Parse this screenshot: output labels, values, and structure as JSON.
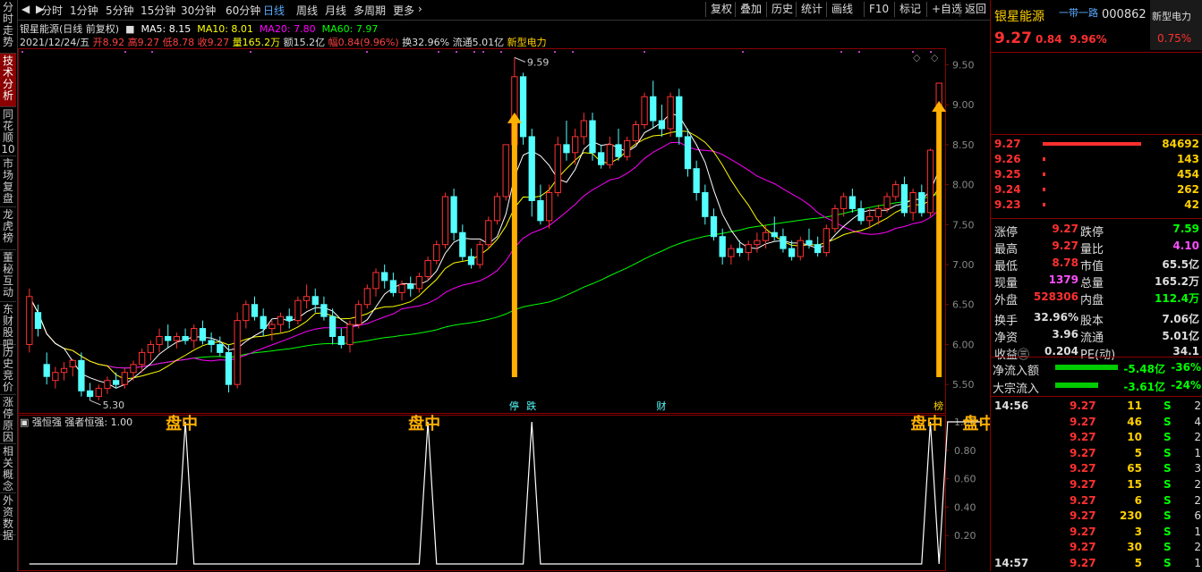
{
  "left_nav": [
    {
      "label": "分时走势",
      "active": false
    },
    {
      "label": "技术分析",
      "active": true
    },
    {
      "label": "同花顺10",
      "active": false
    },
    {
      "label": "市场复盘",
      "active": false
    },
    {
      "label": "龙虎榜",
      "active": false
    },
    {
      "label": "董秘互动",
      "active": false
    },
    {
      "label": "东财股吧",
      "active": false
    },
    {
      "label": "历史竞价",
      "active": false
    },
    {
      "label": "涨停原因",
      "active": false
    },
    {
      "label": "相关概念",
      "active": false
    },
    {
      "label": "外资数据",
      "active": false
    }
  ],
  "periods": [
    "分时",
    "1分钟",
    "5分钟",
    "15分钟",
    "30分钟",
    "60分钟",
    "日线",
    "周线",
    "月线",
    "多周期",
    "更多"
  ],
  "active_period": "日线",
  "tools": [
    "复权",
    "叠加",
    "历史",
    "统计",
    "画线",
    "F10",
    "标记",
    "+自选",
    "返回"
  ],
  "info": {
    "stock_label": "银星能源(日线 前复权)",
    "ma5": "MA5: 8.15",
    "ma10": "MA10: 8.01",
    "ma20": "MA20: 7.80",
    "ma60": "MA60: 7.97",
    "date": "2021/12/24/五",
    "open": "开8.92",
    "high": "高9.27",
    "low": "低8.78",
    "close": "收9.27",
    "vol": "量165.2万",
    "amount": "额15.2亿",
    "change": "幅0.84(9.96%)",
    "turnover": "换32.96%",
    "float": "流通5.01亿",
    "concept": "新型电力"
  },
  "indicator": {
    "label": "强恒强",
    "value": "强者恒强: 1.00"
  },
  "price_axis": [
    "9.50",
    "9.00",
    "8.50",
    "8.00",
    "7.50",
    "7.00",
    "6.50",
    "6.00",
    "5.50"
  ],
  "ind_axis": [
    "1.00",
    "0.80",
    "0.60",
    "0.40",
    "0.20"
  ],
  "annotations": {
    "high_label": "9.59",
    "low_label": "5.30",
    "event1": "停",
    "event2": "跌",
    "event3": "财",
    "event4": "榜"
  },
  "signals": [
    "盘中",
    "盘中",
    "盘中",
    "盘中"
  ],
  "chart_data": {
    "type": "candlestick",
    "ylim": [
      5.2,
      9.65
    ],
    "ohlc": [
      [
        6.0,
        6.7,
        5.9,
        6.6
      ],
      [
        6.4,
        6.5,
        6.1,
        6.2
      ],
      [
        5.75,
        5.9,
        5.5,
        5.6
      ],
      [
        5.55,
        5.72,
        5.45,
        5.65
      ],
      [
        5.65,
        5.78,
        5.55,
        5.7
      ],
      [
        5.72,
        5.82,
        5.6,
        5.8
      ],
      [
        5.8,
        5.9,
        5.35,
        5.42
      ],
      [
        5.42,
        5.52,
        5.3,
        5.35
      ],
      [
        5.35,
        5.5,
        5.3,
        5.45
      ],
      [
        5.45,
        5.6,
        5.38,
        5.55
      ],
      [
        5.55,
        5.65,
        5.45,
        5.5
      ],
      [
        5.5,
        5.7,
        5.45,
        5.65
      ],
      [
        5.65,
        5.8,
        5.55,
        5.75
      ],
      [
        5.75,
        5.95,
        5.65,
        5.9
      ],
      [
        5.9,
        6.05,
        5.8,
        6.0
      ],
      [
        6.0,
        6.2,
        5.9,
        6.1
      ],
      [
        6.1,
        6.25,
        5.95,
        6.05
      ],
      [
        6.05,
        6.15,
        5.95,
        6.1
      ],
      [
        6.1,
        6.2,
        6.0,
        6.05
      ],
      [
        6.05,
        6.25,
        5.95,
        6.2
      ],
      [
        6.2,
        6.3,
        6.0,
        6.05
      ],
      [
        6.05,
        6.15,
        5.9,
        6.0
      ],
      [
        6.0,
        6.1,
        5.85,
        5.9
      ],
      [
        5.9,
        6.0,
        5.4,
        5.5
      ],
      [
        5.5,
        6.4,
        5.45,
        6.3
      ],
      [
        6.3,
        6.55,
        6.2,
        6.5
      ],
      [
        6.5,
        6.6,
        6.3,
        6.35
      ],
      [
        6.35,
        6.45,
        6.1,
        6.2
      ],
      [
        6.2,
        6.3,
        6.05,
        6.25
      ],
      [
        6.25,
        6.4,
        6.15,
        6.35
      ],
      [
        6.35,
        6.45,
        6.2,
        6.3
      ],
      [
        6.3,
        6.6,
        6.25,
        6.55
      ],
      [
        6.55,
        6.75,
        6.45,
        6.6
      ],
      [
        6.6,
        6.7,
        6.4,
        6.5
      ],
      [
        6.5,
        6.6,
        6.3,
        6.35
      ],
      [
        6.35,
        6.45,
        6.0,
        6.1
      ],
      [
        6.1,
        6.2,
        5.95,
        6.0
      ],
      [
        6.0,
        6.3,
        5.9,
        6.25
      ],
      [
        6.25,
        6.55,
        6.2,
        6.5
      ],
      [
        6.5,
        6.75,
        6.45,
        6.7
      ],
      [
        6.7,
        6.95,
        6.6,
        6.9
      ],
      [
        6.9,
        7.0,
        6.7,
        6.8
      ],
      [
        6.8,
        6.9,
        6.6,
        6.65
      ],
      [
        6.65,
        6.8,
        6.55,
        6.75
      ],
      [
        6.75,
        6.85,
        6.6,
        6.7
      ],
      [
        6.7,
        6.9,
        6.65,
        6.85
      ],
      [
        6.85,
        7.1,
        6.8,
        7.05
      ],
      [
        7.05,
        7.3,
        7.0,
        7.25
      ],
      [
        7.25,
        7.9,
        7.2,
        7.85
      ],
      [
        7.85,
        7.95,
        7.3,
        7.4
      ],
      [
        7.4,
        7.5,
        7.05,
        7.1
      ],
      [
        7.1,
        7.2,
        6.95,
        7.0
      ],
      [
        7.0,
        7.3,
        6.95,
        7.25
      ],
      [
        7.25,
        7.6,
        7.2,
        7.55
      ],
      [
        7.55,
        7.9,
        7.5,
        7.85
      ],
      [
        7.85,
        8.5,
        7.8,
        8.5
      ],
      [
        8.5,
        9.59,
        8.4,
        9.35
      ],
      [
        9.35,
        9.4,
        8.5,
        8.6
      ],
      [
        8.6,
        8.7,
        7.6,
        7.8
      ],
      [
        7.8,
        8.0,
        7.5,
        7.55
      ],
      [
        7.55,
        8.0,
        7.45,
        7.9
      ],
      [
        7.9,
        8.6,
        7.85,
        8.5
      ],
      [
        8.5,
        8.8,
        8.3,
        8.4
      ],
      [
        8.4,
        8.7,
        8.25,
        8.6
      ],
      [
        8.6,
        8.9,
        8.5,
        8.8
      ],
      [
        8.8,
        8.9,
        8.3,
        8.4
      ],
      [
        8.4,
        8.5,
        8.2,
        8.25
      ],
      [
        8.25,
        8.6,
        8.2,
        8.5
      ],
      [
        8.5,
        8.7,
        8.3,
        8.35
      ],
      [
        8.35,
        8.6,
        8.3,
        8.55
      ],
      [
        8.55,
        8.8,
        8.5,
        8.75
      ],
      [
        8.75,
        9.15,
        8.7,
        9.1
      ],
      [
        9.1,
        9.3,
        8.7,
        8.8
      ],
      [
        8.8,
        9.0,
        8.6,
        8.7
      ],
      [
        8.7,
        9.15,
        8.6,
        9.1
      ],
      [
        9.1,
        9.2,
        8.5,
        8.6
      ],
      [
        8.6,
        8.7,
        8.1,
        8.2
      ],
      [
        8.2,
        8.3,
        7.8,
        7.9
      ],
      [
        7.9,
        8.0,
        7.5,
        7.6
      ],
      [
        7.6,
        7.7,
        7.3,
        7.35
      ],
      [
        7.35,
        7.45,
        7.0,
        7.1
      ],
      [
        7.1,
        7.25,
        7.0,
        7.2
      ],
      [
        7.2,
        7.3,
        7.1,
        7.15
      ],
      [
        7.15,
        7.3,
        7.05,
        7.25
      ],
      [
        7.25,
        7.4,
        7.15,
        7.3
      ],
      [
        7.3,
        7.5,
        7.2,
        7.4
      ],
      [
        7.4,
        7.6,
        7.3,
        7.35
      ],
      [
        7.35,
        7.45,
        7.15,
        7.2
      ],
      [
        7.2,
        7.3,
        7.05,
        7.1
      ],
      [
        7.1,
        7.35,
        7.05,
        7.3
      ],
      [
        7.3,
        7.45,
        7.2,
        7.25
      ],
      [
        7.25,
        7.35,
        7.1,
        7.15
      ],
      [
        7.15,
        7.5,
        7.1,
        7.45
      ],
      [
        7.45,
        7.75,
        7.4,
        7.7
      ],
      [
        7.7,
        7.9,
        7.6,
        7.85
      ],
      [
        7.85,
        7.95,
        7.65,
        7.7
      ],
      [
        7.7,
        7.8,
        7.5,
        7.55
      ],
      [
        7.55,
        7.7,
        7.45,
        7.6
      ],
      [
        7.6,
        7.75,
        7.5,
        7.7
      ],
      [
        7.7,
        7.9,
        7.65,
        7.85
      ],
      [
        7.85,
        8.05,
        7.8,
        8.0
      ],
      [
        8.0,
        8.1,
        7.6,
        7.65
      ],
      [
        7.65,
        7.95,
        7.55,
        7.9
      ],
      [
        7.9,
        8.0,
        7.6,
        7.65
      ],
      [
        7.65,
        8.45,
        7.6,
        8.43
      ],
      [
        8.92,
        9.27,
        8.78,
        9.27
      ]
    ],
    "ma5_color": "#ffffff",
    "ma10_color": "#ffff00",
    "ma20_color": "#ff00ff",
    "ma60_color": "#00ff00",
    "signal_bars": [
      18,
      46,
      58,
      104,
      110,
      106
    ]
  },
  "right": {
    "name": "银星能源",
    "tag": "一带一路",
    "code": "000862",
    "concept": "新型电力",
    "price": "9.27",
    "change": "0.84",
    "pct": "9.96%",
    "badge": "0.75%",
    "asks": [
      {
        "p": "9.27",
        "v": "84692",
        "bar": 1.0
      },
      {
        "p": "9.26",
        "v": "143",
        "bar": 0.02
      },
      {
        "p": "9.25",
        "v": "454",
        "bar": 0.02
      },
      {
        "p": "9.24",
        "v": "262",
        "bar": 0.02
      },
      {
        "p": "9.23",
        "v": "42",
        "bar": 0.02
      }
    ],
    "stats": [
      [
        "涨停",
        "9.27",
        "跌停",
        "7.59"
      ],
      [
        "最高",
        "9.27",
        "量比",
        "4.10"
      ],
      [
        "最低",
        "8.78",
        "市值",
        "65.5亿"
      ],
      [
        "现量",
        "1379",
        "总量",
        "165.2万"
      ],
      [
        "外盘",
        "528306",
        "内盘",
        "112.4万"
      ],
      [
        "换手",
        "32.96%",
        "股本",
        "7.06亿"
      ],
      [
        "净资",
        "3.96",
        "流通",
        "5.01亿"
      ],
      [
        "收益㊂",
        "0.204",
        "PE(动)",
        "34.1"
      ]
    ],
    "flows": [
      {
        "label": "净流入额",
        "val": "-5.48亿",
        "pct": "-36%"
      },
      {
        "label": "大宗流入",
        "val": "-3.61亿",
        "pct": "-24%"
      }
    ],
    "ticks": [
      {
        "t": "14:56",
        "p": "9.27",
        "v": "11",
        "s": "S",
        "n": "2"
      },
      {
        "t": "",
        "p": "9.27",
        "v": "46",
        "s": "S",
        "n": "4"
      },
      {
        "t": "",
        "p": "9.27",
        "v": "10",
        "s": "S",
        "n": "2"
      },
      {
        "t": "",
        "p": "9.27",
        "v": "5",
        "s": "S",
        "n": "1"
      },
      {
        "t": "",
        "p": "9.27",
        "v": "65",
        "s": "S",
        "n": "3"
      },
      {
        "t": "",
        "p": "9.27",
        "v": "15",
        "s": "S",
        "n": "2"
      },
      {
        "t": "",
        "p": "9.27",
        "v": "6",
        "s": "S",
        "n": "2"
      },
      {
        "t": "",
        "p": "9.27",
        "v": "230",
        "s": "S",
        "n": "6"
      },
      {
        "t": "",
        "p": "9.27",
        "v": "3",
        "s": "S",
        "n": "1"
      },
      {
        "t": "",
        "p": "9.27",
        "v": "30",
        "s": "S",
        "n": "2"
      },
      {
        "t": "14:57",
        "p": "9.27",
        "v": "5",
        "s": "S",
        "n": "1"
      }
    ]
  }
}
